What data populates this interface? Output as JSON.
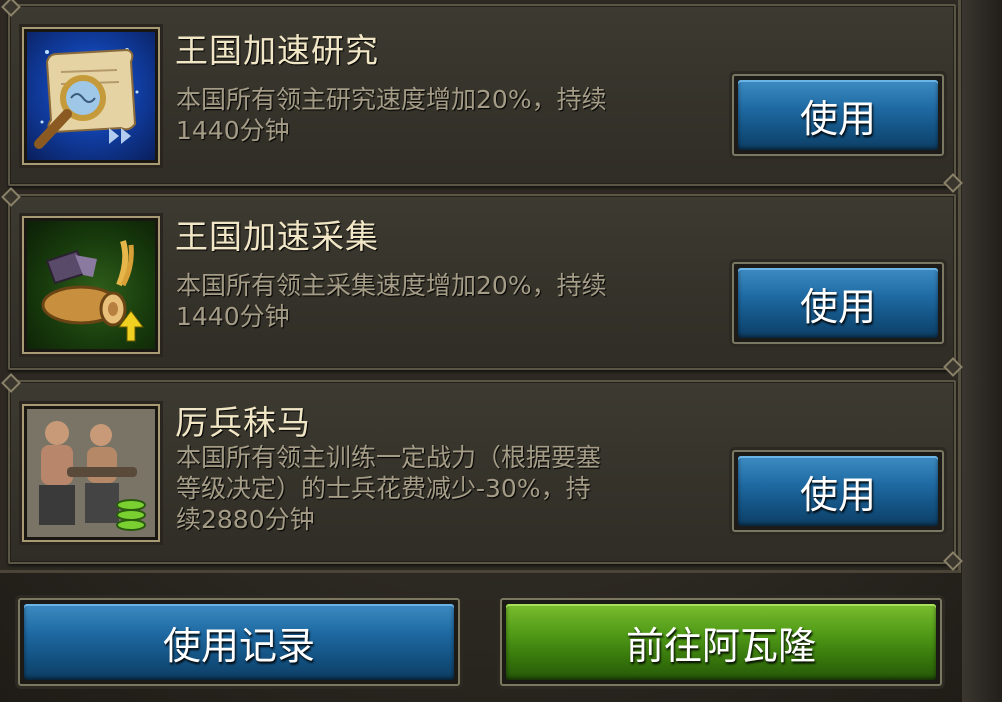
{
  "items": [
    {
      "title": "王国加速研究",
      "desc_line1": "本国所有领主研究速度增加20%，持续",
      "desc_line2": "1440分钟",
      "desc_line3": "",
      "icon": "scroll-magnifier-icon",
      "button": "使用"
    },
    {
      "title": "王国加速采集",
      "desc_line1": "本国所有领主采集速度增加20%，持续",
      "desc_line2": "1440分钟",
      "desc_line3": "",
      "icon": "resources-upgrade-icon",
      "button": "使用"
    },
    {
      "title": "厉兵秣马",
      "desc_line1": "本国所有领主训练一定战力（根据要塞",
      "desc_line2": "等级决定）的士兵花费减少-30%，持",
      "desc_line3": "续2880分钟",
      "icon": "soldiers-training-icon",
      "button": "使用"
    }
  ],
  "footer": {
    "history_button": "使用记录",
    "goto_button": "前往阿瓦隆"
  },
  "colors": {
    "blue_button": "#1f6aa3",
    "green_button": "#4f9a17",
    "title_text": "#f1e6c5",
    "desc_text": "#a49c86"
  }
}
